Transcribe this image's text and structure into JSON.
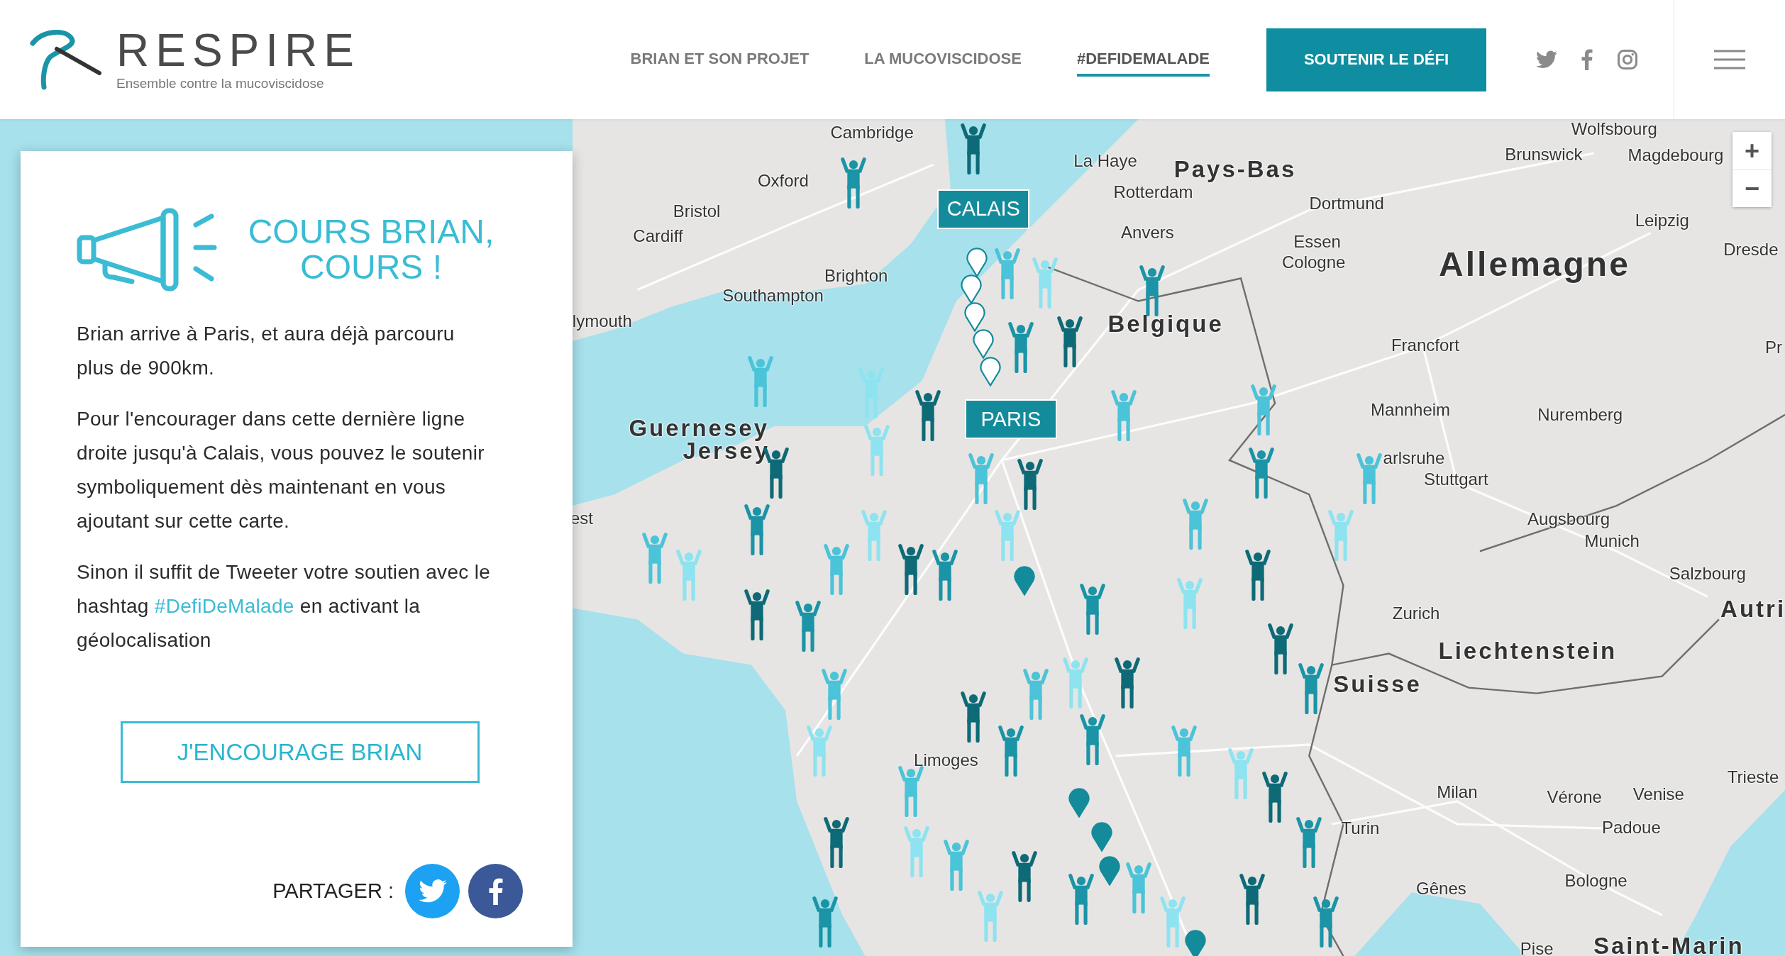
{
  "header": {
    "logo": {
      "name": "RESPIRE",
      "tagline": "Ensemble contre la mucoviscidose"
    },
    "nav": [
      {
        "label": "BRIAN ET SON PROJET",
        "selected": false
      },
      {
        "label": "LA MUCOVISCIDOSE",
        "selected": false
      },
      {
        "label": "#DEFIDEMALADE",
        "selected": true
      }
    ],
    "cta": "SOUTENIR LE DÉFI"
  },
  "card": {
    "title": "COURS BRIAN, COURS !",
    "paragraphs": [
      {
        "text": "Brian arrive à Paris, et aura déjà parcouru plus de 900km."
      },
      {
        "text": "Pour l'encourager dans cette dernière ligne droite jusqu'à Calais, vous pouvez le soutenir symboliquement dès maintenant en vous ajoutant sur cette carte."
      },
      {
        "text": "Sinon il suffit de Tweeter votre soutien avec le hashtag",
        "link": "#DefiDeMalade",
        "after": "en activant la géolocalisation"
      }
    ],
    "button": "J'ENCOURAGE BRIAN",
    "share_label": "PARTAGER :"
  },
  "map": {
    "banners": [
      "CALAIS",
      "PARIS"
    ],
    "zoom": [
      "+",
      "−"
    ],
    "labels": [
      {
        "text": "Cambridge",
        "kind": "city"
      },
      {
        "text": "Oxford",
        "kind": "city"
      },
      {
        "text": "Bristol",
        "kind": "city"
      },
      {
        "text": "Cardiff",
        "kind": "city"
      },
      {
        "text": "Brighton",
        "kind": "city"
      },
      {
        "text": "Southampton",
        "kind": "city"
      },
      {
        "text": "lymouth",
        "kind": "city"
      },
      {
        "text": "est",
        "kind": "city"
      },
      {
        "text": "Guernesey",
        "kind": "country"
      },
      {
        "text": "Jersey",
        "kind": "country"
      },
      {
        "text": "La Haye",
        "kind": "city"
      },
      {
        "text": "Rotterdam",
        "kind": "city"
      },
      {
        "text": "Pays-Bas",
        "kind": "country"
      },
      {
        "text": "Anvers",
        "kind": "city"
      },
      {
        "text": "Belgique",
        "kind": "country"
      },
      {
        "text": "Dortmund",
        "kind": "city"
      },
      {
        "text": "Essen",
        "kind": "city"
      },
      {
        "text": "Cologne",
        "kind": "city"
      },
      {
        "text": "Wolfsbourg",
        "kind": "city"
      },
      {
        "text": "Brunswick",
        "kind": "city"
      },
      {
        "text": "Magdebourg",
        "kind": "city"
      },
      {
        "text": "Leipzig",
        "kind": "city"
      },
      {
        "text": "Dresde",
        "kind": "city"
      },
      {
        "text": "Allemagne",
        "kind": "major"
      },
      {
        "text": "Francfort",
        "kind": "city"
      },
      {
        "text": "Pr",
        "kind": "city"
      },
      {
        "text": "Mannheim",
        "kind": "city"
      },
      {
        "text": "Nuremberg",
        "kind": "city"
      },
      {
        "text": "arlsruhe",
        "kind": "city"
      },
      {
        "text": "Stuttgart",
        "kind": "city"
      },
      {
        "text": "Augsbourg",
        "kind": "city"
      },
      {
        "text": "Munich",
        "kind": "city"
      },
      {
        "text": "Salzbourg",
        "kind": "city"
      },
      {
        "text": "Autri",
        "kind": "country"
      },
      {
        "text": "Zurich",
        "kind": "city"
      },
      {
        "text": "Liechtenstein",
        "kind": "country"
      },
      {
        "text": "Suisse",
        "kind": "country"
      },
      {
        "text": "Limoges",
        "kind": "city"
      },
      {
        "text": "Milan",
        "kind": "city"
      },
      {
        "text": "Vérone",
        "kind": "city"
      },
      {
        "text": "Venise",
        "kind": "city"
      },
      {
        "text": "Trieste",
        "kind": "city"
      },
      {
        "text": "Padoue",
        "kind": "city"
      },
      {
        "text": "Turin",
        "kind": "city"
      },
      {
        "text": "Bologne",
        "kind": "city"
      },
      {
        "text": "Gênes",
        "kind": "city"
      },
      {
        "text": "Pise",
        "kind": "city"
      },
      {
        "text": "Saint-Marin",
        "kind": "country"
      }
    ]
  }
}
